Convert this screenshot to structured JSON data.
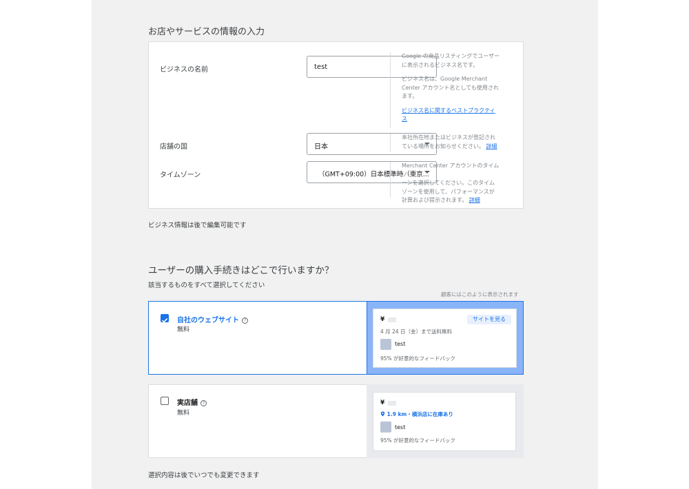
{
  "section1": {
    "title": "お店やサービスの情報の入力",
    "business_name": {
      "label": "ビジネスの名前",
      "value": "test",
      "help_line1": "Google の商品リスティングでユーザー",
      "help_line2": "に表示されるビジネス名です。",
      "help_line3": "ビジネス名は、Google Merchant",
      "help_line4": "Center アカウント名としても使用され",
      "help_line5": "ます。",
      "best_practice_link_line1": "ビジネス名に関するベストプラクティ",
      "best_practice_link_line2": "ス"
    },
    "country": {
      "label": "店舗の国",
      "value": "日本",
      "help_line1": "本社所在地またはビジネスが登記され",
      "help_line2": "ている場所をお知らせください。",
      "details_link": "詳細"
    },
    "timezone": {
      "label": "タイムゾーン",
      "value": "（GMT+09:00）日本標準時（東京...",
      "help_line1": "Merchant Center アカウントのタイムゾ",
      "help_line2": "ーンを選択してください。このタイム",
      "help_line3": "ゾーンを使用して、パフォーマンスが",
      "help_line4": "計算および提示されます。",
      "details_link": "詳細"
    },
    "footer_note": "ビジネス情報は後で編集可能です"
  },
  "section2": {
    "title": "ユーザーの購入手続きはどこで行いますか？",
    "subtitle": "該当するものをすべて選択してください",
    "preview_caption": "顧客にはこのように表示されます",
    "options": [
      {
        "title": "自社のウェブサイト",
        "price": "無料",
        "checked": true,
        "preview": {
          "currency": "¥",
          "visit_button": "サイトを見る",
          "shipping": "4 月 24 日（金）まで送料無料",
          "store": "test",
          "feedback": "95% が好意的なフィードバック"
        }
      },
      {
        "title": "実店舗",
        "price": "無料",
        "checked": false,
        "preview": {
          "currency": "¥",
          "location": "1.9 km・横浜店に在庫あり",
          "store": "test",
          "feedback": "95% が好意的なフィードバック"
        }
      }
    ],
    "footer_note": "選択内容は後でいつでも変更できます"
  },
  "colors": {
    "accent": "#1a73e8",
    "selected_panel": "#8ab4f8",
    "page_bg": "#f1f1f1"
  },
  "icons": [
    "help-circle-icon",
    "checkbox-checked-icon",
    "checkbox-empty-icon",
    "dropdown-arrow-icon",
    "location-pin-icon"
  ]
}
